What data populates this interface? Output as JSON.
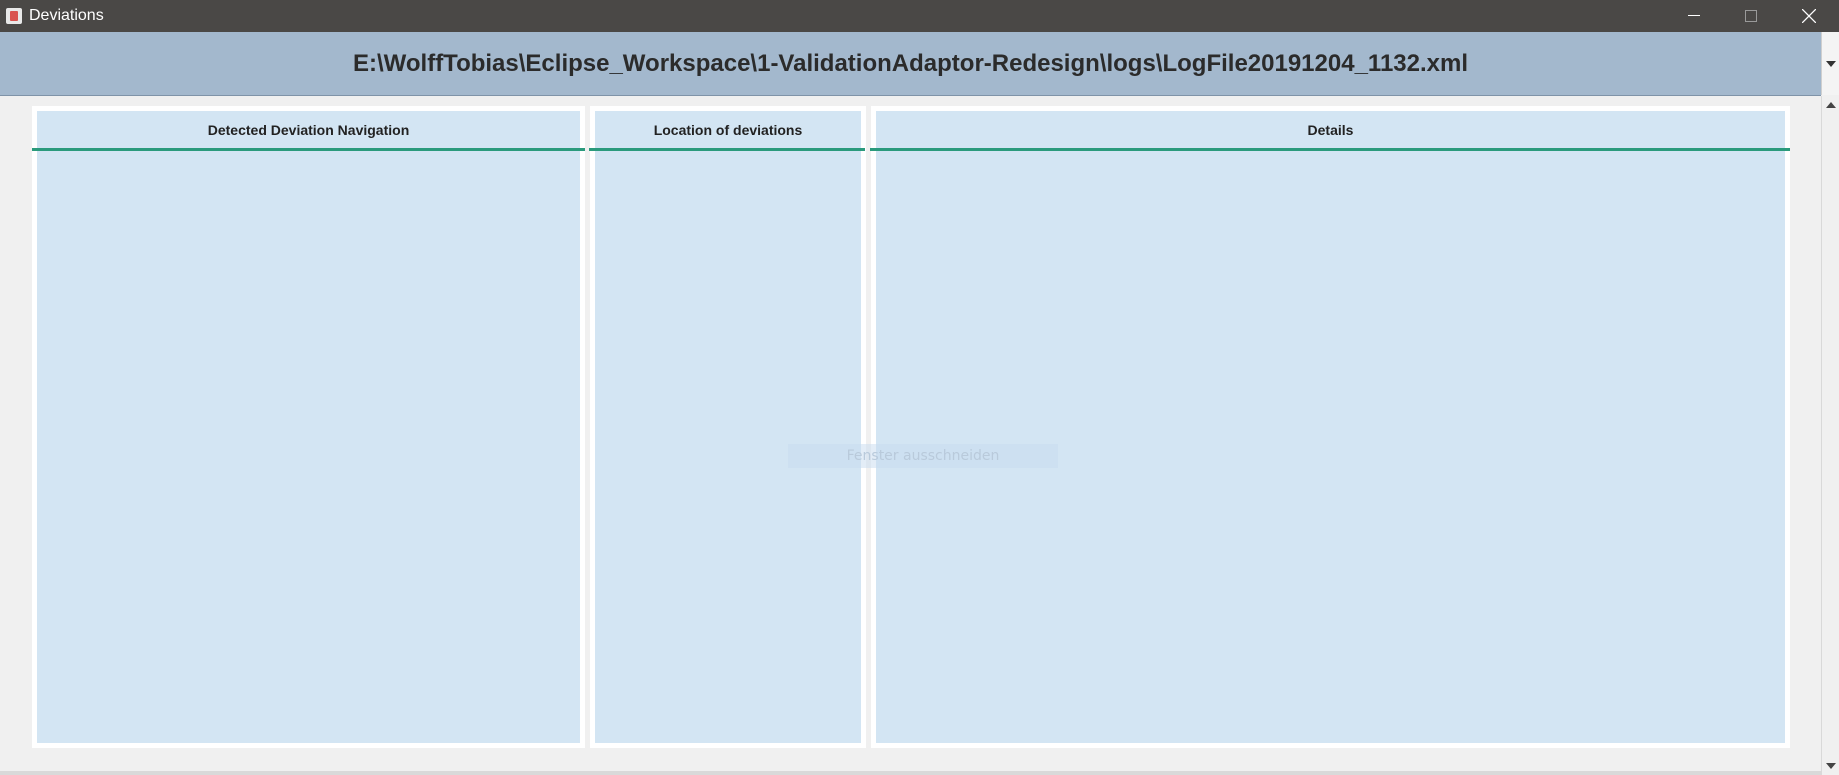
{
  "window": {
    "title": "Deviations"
  },
  "header": {
    "file_path": "E:\\WolffTobias\\Eclipse_Workspace\\1-ValidationAdaptor-Redesign\\logs\\LogFile20191204_1132.xml"
  },
  "panels": [
    {
      "title": "Detected Deviation Navigation"
    },
    {
      "title": "Location of deviations"
    },
    {
      "title": "Details"
    }
  ],
  "overlay": {
    "text": "Fenster ausschneiden"
  },
  "colors": {
    "header_bg": "#a3b8cd",
    "panel_bg": "#d3e5f3",
    "accent_line": "#2a9a7c"
  }
}
